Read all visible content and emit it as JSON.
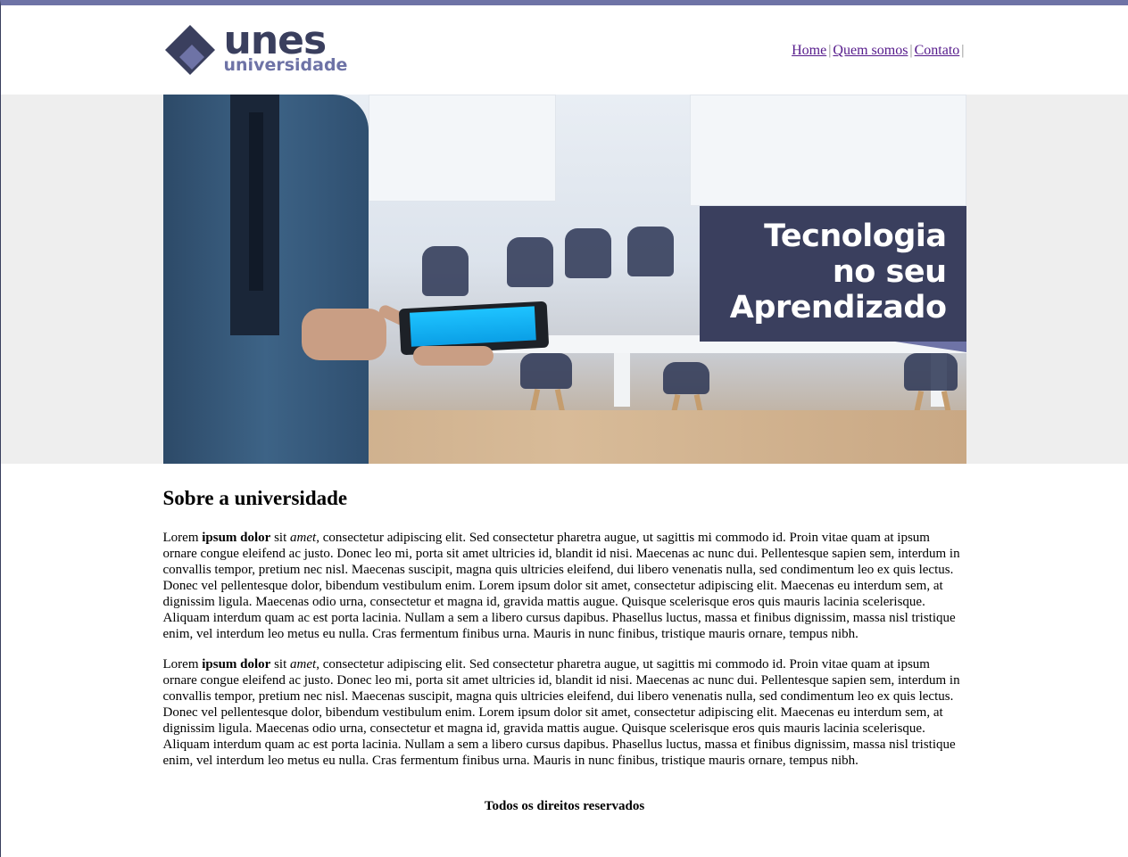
{
  "logo": {
    "main": "unes",
    "sub": "universidade"
  },
  "nav": {
    "home": "Home",
    "about": "Quem somos",
    "contact": "Contato",
    "separator": "|"
  },
  "banner": {
    "line1": "Tecnologia",
    "line2": "no seu",
    "line3": "Aprendizado"
  },
  "section": {
    "title": "Sobre a universidade",
    "paragraphs": [
      {
        "w1": "Lorem",
        "bold": "ipsum dolor",
        "w2": "sit",
        "italic": "amet",
        "rest": ", consectetur adipiscing elit. Sed consectetur pharetra augue, ut sagittis mi commodo id. Proin vitae quam at ipsum ornare congue eleifend ac justo. Donec leo mi, porta sit amet ultricies id, blandit id nisi. Maecenas ac nunc dui. Pellentesque sapien sem, interdum in convallis tempor, pretium nec nisl. Maecenas suscipit, magna quis ultricies eleifend, dui libero venenatis nulla, sed condimentum leo ex quis lectus. Donec vel pellentesque dolor, bibendum vestibulum enim. Lorem ipsum dolor sit amet, consectetur adipiscing elit. Maecenas eu interdum sem, at dignissim ligula. Maecenas odio urna, consectetur et magna id, gravida mattis augue. Quisque scelerisque eros quis mauris lacinia scelerisque. Aliquam interdum quam ac est porta lacinia. Nullam a sem a libero cursus dapibus. Phasellus luctus, massa et finibus dignissim, massa nisl tristique enim, vel interdum leo metus eu nulla. Cras fermentum finibus urna. Mauris in nunc finibus, tristique mauris ornare, tempus nibh."
      },
      {
        "w1": "Lorem",
        "bold": "ipsum dolor",
        "w2": "sit",
        "italic": "amet",
        "rest": ", consectetur adipiscing elit. Sed consectetur pharetra augue, ut sagittis mi commodo id. Proin vitae quam at ipsum ornare congue eleifend ac justo. Donec leo mi, porta sit amet ultricies id, blandit id nisi. Maecenas ac nunc dui. Pellentesque sapien sem, interdum in convallis tempor, pretium nec nisl. Maecenas suscipit, magna quis ultricies eleifend, dui libero venenatis nulla, sed condimentum leo ex quis lectus. Donec vel pellentesque dolor, bibendum vestibulum enim. Lorem ipsum dolor sit amet, consectetur adipiscing elit. Maecenas eu interdum sem, at dignissim ligula. Maecenas odio urna, consectetur et magna id, gravida mattis augue. Quisque scelerisque eros quis mauris lacinia scelerisque. Aliquam interdum quam ac est porta lacinia. Nullam a sem a libero cursus dapibus. Phasellus luctus, massa et finibus dignissim, massa nisl tristique enim, vel interdum leo metus eu nulla. Cras fermentum finibus urna. Mauris in nunc finibus, tristique mauris ornare, tempus nibh."
      }
    ]
  },
  "footer": {
    "text": "Todos os direitos reservados"
  },
  "colors": {
    "brand_dark": "#3a3f5e",
    "brand_light": "#6e73a6",
    "link": "#551a8b"
  }
}
